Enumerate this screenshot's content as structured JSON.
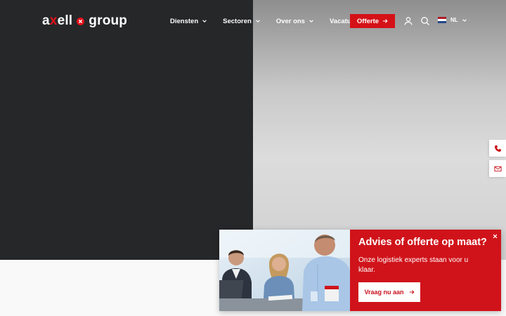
{
  "colors": {
    "brand_red": "#d51118",
    "dark_bg": "#262729",
    "light_bg": "#f9f9f9",
    "white": "#ffffff"
  },
  "header": {
    "logo": {
      "prefix_a": "a",
      "x": "x",
      "suffix": "ell",
      "group": "group"
    },
    "nav": [
      {
        "label": "Diensten",
        "icon": "chevron-down-icon"
      },
      {
        "label": "Sectoren",
        "icon": "chevron-down-icon"
      },
      {
        "label": "Over ons",
        "icon": "chevron-down-icon"
      },
      {
        "label": "Vacatures"
      }
    ],
    "cta_label": "Offerte",
    "cta_icon": "arrow-right-icon",
    "user_icon": "user-icon",
    "search_icon": "search-icon",
    "language": {
      "label": "NL",
      "flag": "netherlands-flag-icon",
      "flag_colors": [
        "#ae1c28",
        "#ffffff",
        "#21468b"
      ]
    }
  },
  "side_contact": {
    "phone_icon": "phone-icon",
    "mail_icon": "mail-icon"
  },
  "popup": {
    "title": "Advies of offerte op maat?",
    "text": "Onze logistiek experts staan voor u klaar.",
    "cta_label": "Vraag nu aan",
    "close_icon": "close-icon"
  }
}
